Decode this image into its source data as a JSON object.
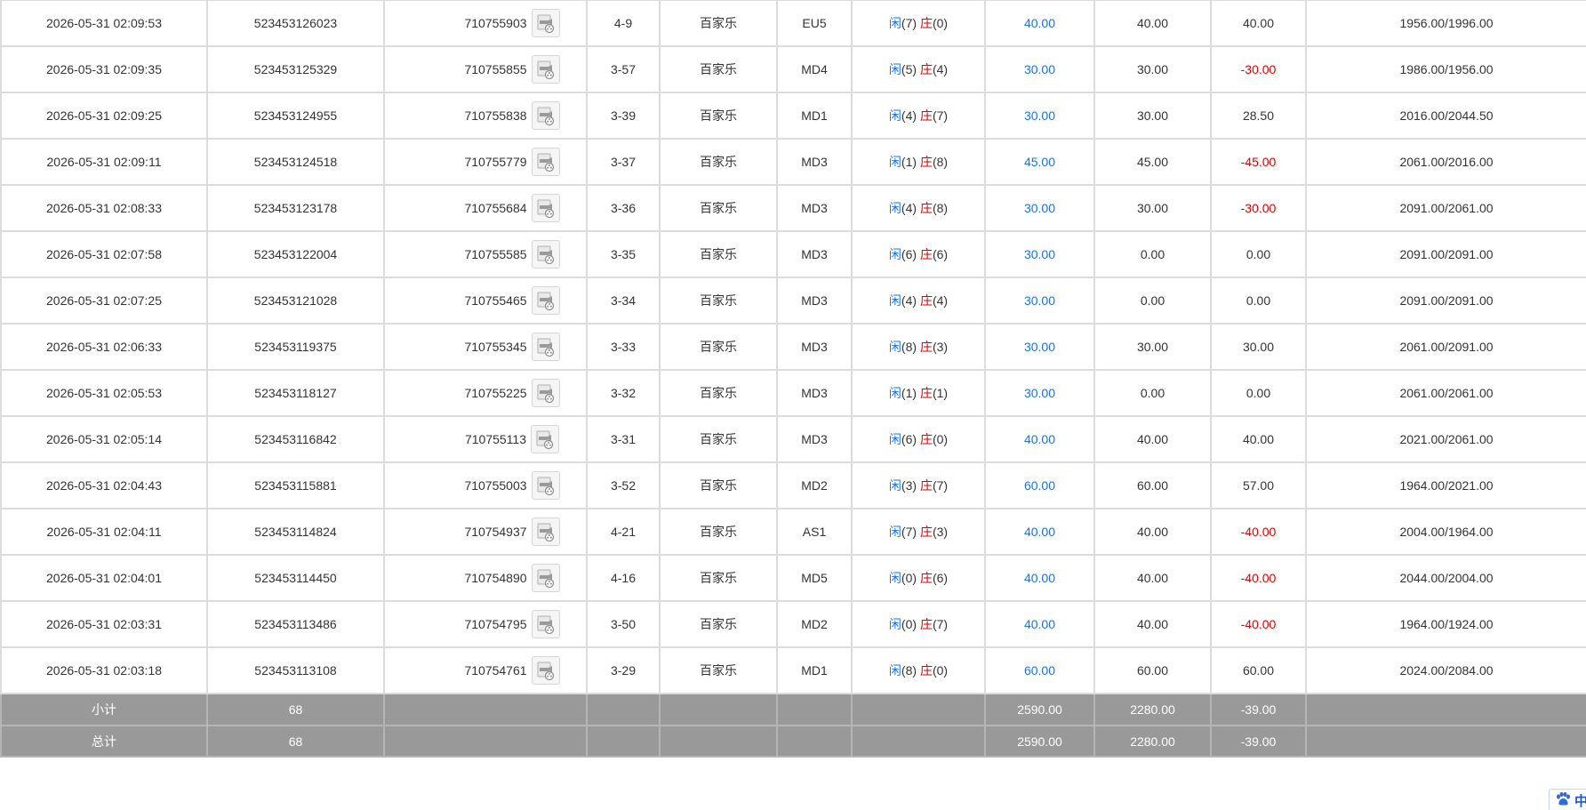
{
  "rows": [
    {
      "time": "2026-05-31 02:09:53",
      "order_id": "523453126023",
      "round_id": "710755903",
      "shoe": "4-9",
      "game": "百家乐",
      "table": "EU5",
      "player": "闲",
      "player_points": "(7)",
      "banker": "庄",
      "banker_points": "(0)",
      "bet": "40.00",
      "valid_bet": "40.00",
      "win_loss": "40.00",
      "win_loss_negative": false,
      "balance": "1956.00/1996.00"
    },
    {
      "time": "2026-05-31 02:09:35",
      "order_id": "523453125329",
      "round_id": "710755855",
      "shoe": "3-57",
      "game": "百家乐",
      "table": "MD4",
      "player": "闲",
      "player_points": "(5)",
      "banker": "庄",
      "banker_points": "(4)",
      "bet": "30.00",
      "valid_bet": "30.00",
      "win_loss": "-30.00",
      "win_loss_negative": true,
      "balance": "1986.00/1956.00"
    },
    {
      "time": "2026-05-31 02:09:25",
      "order_id": "523453124955",
      "round_id": "710755838",
      "shoe": "3-39",
      "game": "百家乐",
      "table": "MD1",
      "player": "闲",
      "player_points": "(4)",
      "banker": "庄",
      "banker_points": "(7)",
      "bet": "30.00",
      "valid_bet": "30.00",
      "win_loss": "28.50",
      "win_loss_negative": false,
      "balance": "2016.00/2044.50"
    },
    {
      "time": "2026-05-31 02:09:11",
      "order_id": "523453124518",
      "round_id": "710755779",
      "shoe": "3-37",
      "game": "百家乐",
      "table": "MD3",
      "player": "闲",
      "player_points": "(1)",
      "banker": "庄",
      "banker_points": "(8)",
      "bet": "45.00",
      "valid_bet": "45.00",
      "win_loss": "-45.00",
      "win_loss_negative": true,
      "balance": "2061.00/2016.00"
    },
    {
      "time": "2026-05-31 02:08:33",
      "order_id": "523453123178",
      "round_id": "710755684",
      "shoe": "3-36",
      "game": "百家乐",
      "table": "MD3",
      "player": "闲",
      "player_points": "(4)",
      "banker": "庄",
      "banker_points": "(8)",
      "bet": "30.00",
      "valid_bet": "30.00",
      "win_loss": "-30.00",
      "win_loss_negative": true,
      "balance": "2091.00/2061.00"
    },
    {
      "time": "2026-05-31 02:07:58",
      "order_id": "523453122004",
      "round_id": "710755585",
      "shoe": "3-35",
      "game": "百家乐",
      "table": "MD3",
      "player": "闲",
      "player_points": "(6)",
      "banker": "庄",
      "banker_points": "(6)",
      "bet": "30.00",
      "valid_bet": "0.00",
      "win_loss": "0.00",
      "win_loss_negative": false,
      "balance": "2091.00/2091.00"
    },
    {
      "time": "2026-05-31 02:07:25",
      "order_id": "523453121028",
      "round_id": "710755465",
      "shoe": "3-34",
      "game": "百家乐",
      "table": "MD3",
      "player": "闲",
      "player_points": "(4)",
      "banker": "庄",
      "banker_points": "(4)",
      "bet": "30.00",
      "valid_bet": "0.00",
      "win_loss": "0.00",
      "win_loss_negative": false,
      "balance": "2091.00/2091.00"
    },
    {
      "time": "2026-05-31 02:06:33",
      "order_id": "523453119375",
      "round_id": "710755345",
      "shoe": "3-33",
      "game": "百家乐",
      "table": "MD3",
      "player": "闲",
      "player_points": "(8)",
      "banker": "庄",
      "banker_points": "(3)",
      "bet": "30.00",
      "valid_bet": "30.00",
      "win_loss": "30.00",
      "win_loss_negative": false,
      "balance": "2061.00/2091.00"
    },
    {
      "time": "2026-05-31 02:05:53",
      "order_id": "523453118127",
      "round_id": "710755225",
      "shoe": "3-32",
      "game": "百家乐",
      "table": "MD3",
      "player": "闲",
      "player_points": "(1)",
      "banker": "庄",
      "banker_points": "(1)",
      "bet": "30.00",
      "valid_bet": "0.00",
      "win_loss": "0.00",
      "win_loss_negative": false,
      "balance": "2061.00/2061.00"
    },
    {
      "time": "2026-05-31 02:05:14",
      "order_id": "523453116842",
      "round_id": "710755113",
      "shoe": "3-31",
      "game": "百家乐",
      "table": "MD3",
      "player": "闲",
      "player_points": "(6)",
      "banker": "庄",
      "banker_points": "(0)",
      "bet": "40.00",
      "valid_bet": "40.00",
      "win_loss": "40.00",
      "win_loss_negative": false,
      "balance": "2021.00/2061.00"
    },
    {
      "time": "2026-05-31 02:04:43",
      "order_id": "523453115881",
      "round_id": "710755003",
      "shoe": "3-52",
      "game": "百家乐",
      "table": "MD2",
      "player": "闲",
      "player_points": "(3)",
      "banker": "庄",
      "banker_points": "(7)",
      "bet": "60.00",
      "valid_bet": "60.00",
      "win_loss": "57.00",
      "win_loss_negative": false,
      "balance": "1964.00/2021.00"
    },
    {
      "time": "2026-05-31 02:04:11",
      "order_id": "523453114824",
      "round_id": "710754937",
      "shoe": "4-21",
      "game": "百家乐",
      "table": "AS1",
      "player": "闲",
      "player_points": "(7)",
      "banker": "庄",
      "banker_points": "(3)",
      "bet": "40.00",
      "valid_bet": "40.00",
      "win_loss": "-40.00",
      "win_loss_negative": true,
      "balance": "2004.00/1964.00"
    },
    {
      "time": "2026-05-31 02:04:01",
      "order_id": "523453114450",
      "round_id": "710754890",
      "shoe": "4-16",
      "game": "百家乐",
      "table": "MD5",
      "player": "闲",
      "player_points": "(0)",
      "banker": "庄",
      "banker_points": "(6)",
      "bet": "40.00",
      "valid_bet": "40.00",
      "win_loss": "-40.00",
      "win_loss_negative": true,
      "balance": "2044.00/2004.00"
    },
    {
      "time": "2026-05-31 02:03:31",
      "order_id": "523453113486",
      "round_id": "710754795",
      "shoe": "3-50",
      "game": "百家乐",
      "table": "MD2",
      "player": "闲",
      "player_points": "(0)",
      "banker": "庄",
      "banker_points": "(7)",
      "bet": "40.00",
      "valid_bet": "40.00",
      "win_loss": "-40.00",
      "win_loss_negative": true,
      "balance": "1964.00/1924.00"
    },
    {
      "time": "2026-05-31 02:03:18",
      "order_id": "523453113108",
      "round_id": "710754761",
      "shoe": "3-29",
      "game": "百家乐",
      "table": "MD1",
      "player": "闲",
      "player_points": "(8)",
      "banker": "庄",
      "banker_points": "(0)",
      "bet": "60.00",
      "valid_bet": "60.00",
      "win_loss": "60.00",
      "win_loss_negative": false,
      "balance": "2024.00/2084.00"
    }
  ],
  "subtotal": {
    "label": "小计",
    "count": "68",
    "bet": "2590.00",
    "valid_bet": "2280.00",
    "win_loss": "-39.00"
  },
  "total": {
    "label": "总计",
    "count": "68",
    "bet": "2590.00",
    "valid_bet": "2280.00",
    "win_loss": "-39.00"
  },
  "language_widget": {
    "icon": "paw-icon",
    "label": "中"
  },
  "colors": {
    "blue": "#1a73e8",
    "red": "#e00000",
    "summary_bg": "#999999",
    "border": "#dcdcdc"
  }
}
